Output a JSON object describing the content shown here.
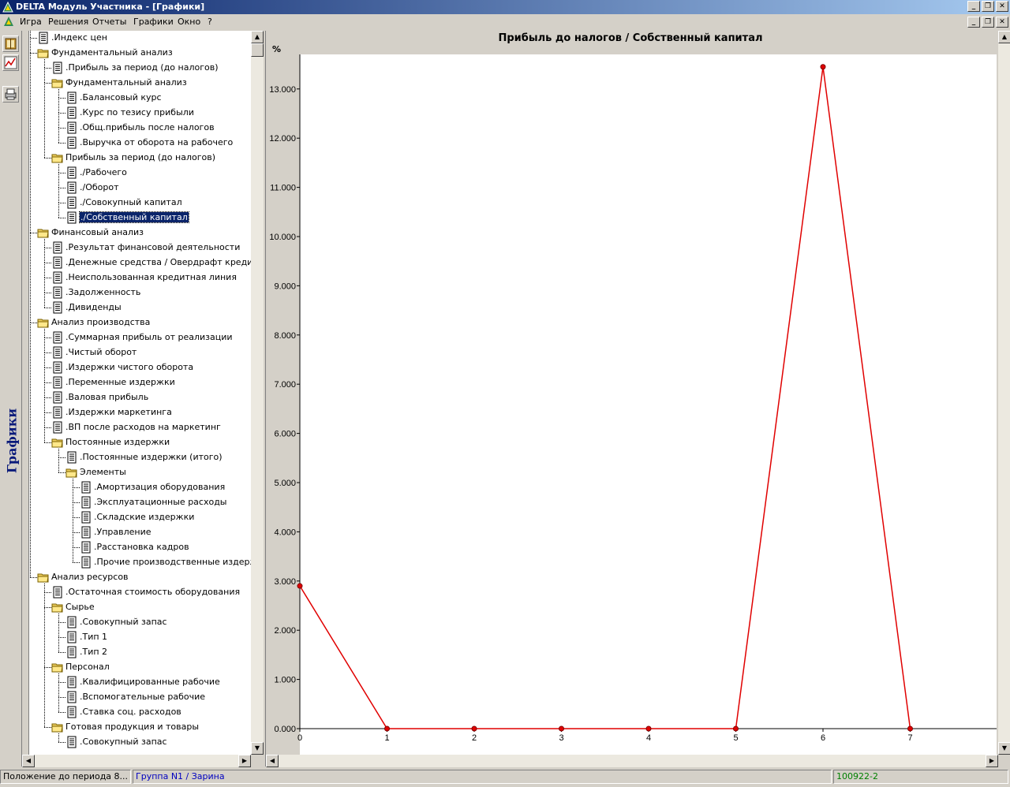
{
  "window": {
    "title": "DELTA Модуль Участника - [Графики]"
  },
  "menu": [
    {
      "label": "Игра",
      "name": "menu-game"
    },
    {
      "label": "Решения",
      "name": "menu-decisions"
    },
    {
      "label": "Отчеты",
      "name": "menu-reports"
    },
    {
      "label": "Графики",
      "name": "menu-charts"
    },
    {
      "label": "Окно",
      "name": "menu-window"
    },
    {
      "label": "?",
      "name": "menu-help"
    }
  ],
  "sidebar": {
    "label": "Графики",
    "buttons": [
      "book-icon",
      "chart-icon",
      "printer-icon"
    ]
  },
  "tree": [
    {
      "level": 0,
      "type": "doc",
      "label": ".Индекс цен"
    },
    {
      "level": 0,
      "type": "folder",
      "label": "Фундаментальный анализ"
    },
    {
      "level": 1,
      "type": "doc",
      "label": ".Прибыль за период (до налогов)"
    },
    {
      "level": 1,
      "type": "folder",
      "label": "Фундаментальный анализ"
    },
    {
      "level": 2,
      "type": "doc",
      "label": ".Балансовый курс"
    },
    {
      "level": 2,
      "type": "doc",
      "label": ".Курс по тезису прибыли"
    },
    {
      "level": 2,
      "type": "doc",
      "label": ".Общ.прибыль после налогов"
    },
    {
      "level": 2,
      "type": "doc",
      "label": ".Выручка от оборота на рабочего"
    },
    {
      "level": 1,
      "type": "folder",
      "label": "Прибыль за период (до налогов)"
    },
    {
      "level": 2,
      "type": "doc",
      "label": "./Рабочего"
    },
    {
      "level": 2,
      "type": "doc",
      "label": "./Оборот"
    },
    {
      "level": 2,
      "type": "doc",
      "label": "./Совокупный капитал"
    },
    {
      "level": 2,
      "type": "doc",
      "label": "./Собственный капитал",
      "selected": true
    },
    {
      "level": 0,
      "type": "folder",
      "label": "Финансовый анализ"
    },
    {
      "level": 1,
      "type": "doc",
      "label": ".Результат финансовой деятельности"
    },
    {
      "level": 1,
      "type": "doc",
      "label": ".Денежные средства / Овердрафт кредит"
    },
    {
      "level": 1,
      "type": "doc",
      "label": ".Неиспользованная кредитная линия"
    },
    {
      "level": 1,
      "type": "doc",
      "label": ".Задолженность"
    },
    {
      "level": 1,
      "type": "doc",
      "label": ".Дивиденды"
    },
    {
      "level": 0,
      "type": "folder",
      "label": "Анализ производства"
    },
    {
      "level": 1,
      "type": "doc",
      "label": ".Суммарная прибыль от реализации"
    },
    {
      "level": 1,
      "type": "doc",
      "label": ".Чистый оборот"
    },
    {
      "level": 1,
      "type": "doc",
      "label": ".Издержки чистого оборота"
    },
    {
      "level": 1,
      "type": "doc",
      "label": ".Переменные издержки"
    },
    {
      "level": 1,
      "type": "doc",
      "label": ".Валовая прибыль"
    },
    {
      "level": 1,
      "type": "doc",
      "label": ".Издержки маркетинга"
    },
    {
      "level": 1,
      "type": "doc",
      "label": ".ВП после расходов на маркетинг"
    },
    {
      "level": 1,
      "type": "folder",
      "label": "Постоянные издержки"
    },
    {
      "level": 2,
      "type": "doc",
      "label": ".Постоянные издержки (итого)"
    },
    {
      "level": 2,
      "type": "folder",
      "label": "Элементы"
    },
    {
      "level": 3,
      "type": "doc",
      "label": ".Амортизация оборудования"
    },
    {
      "level": 3,
      "type": "doc",
      "label": ".Эксплуатационные расходы"
    },
    {
      "level": 3,
      "type": "doc",
      "label": ".Складские издержки"
    },
    {
      "level": 3,
      "type": "doc",
      "label": ".Управление"
    },
    {
      "level": 3,
      "type": "doc",
      "label": ".Расстановка кадров"
    },
    {
      "level": 3,
      "type": "doc",
      "label": ".Прочие производственные издержки"
    },
    {
      "level": 0,
      "type": "folder",
      "label": "Анализ ресурсов"
    },
    {
      "level": 1,
      "type": "doc",
      "label": ".Остаточная стоимость оборудования"
    },
    {
      "level": 1,
      "type": "folder",
      "label": "Сырье"
    },
    {
      "level": 2,
      "type": "doc",
      "label": ".Совокупный запас"
    },
    {
      "level": 2,
      "type": "doc",
      "label": ".Тип 1"
    },
    {
      "level": 2,
      "type": "doc",
      "label": ".Тип 2"
    },
    {
      "level": 1,
      "type": "folder",
      "label": "Персонал"
    },
    {
      "level": 2,
      "type": "doc",
      "label": ".Квалифицированные рабочие"
    },
    {
      "level": 2,
      "type": "doc",
      "label": ".Вспомогательные рабочие"
    },
    {
      "level": 2,
      "type": "doc",
      "label": ".Ставка соц. расходов"
    },
    {
      "level": 1,
      "type": "folder",
      "label": "Готовая продукция и товары"
    },
    {
      "level": 2,
      "type": "doc",
      "label": ".Совокупный запас"
    }
  ],
  "chart_data": {
    "type": "line",
    "title": "Прибыль до налогов / Собственный капитал",
    "ylabel": "%",
    "xlabel": "",
    "x": [
      0,
      1,
      2,
      3,
      4,
      5,
      6,
      7
    ],
    "xticks": [
      "0",
      "1",
      "2",
      "3",
      "4",
      "5",
      "6",
      "7"
    ],
    "xlim": [
      0,
      8
    ],
    "ylim": [
      0,
      13.7
    ],
    "yticks": [
      "0.000",
      "1.000",
      "2.000",
      "3.000",
      "4.000",
      "5.000",
      "6.000",
      "7.000",
      "8.000",
      "9.000",
      "10.000",
      "11.000",
      "12.000",
      "13.000"
    ],
    "ytick_values": [
      0,
      1,
      2,
      3,
      4,
      5,
      6,
      7,
      8,
      9,
      10,
      11,
      12,
      13
    ],
    "series": [
      {
        "values": [
          2.9,
          0,
          0,
          0,
          0,
          0,
          13.45,
          0
        ]
      }
    ],
    "grid": false,
    "colors": {
      "line": "#e00000",
      "marker_fill": "#e00000",
      "marker_edge": "#800000"
    }
  },
  "status": {
    "position": "Положение до периода 8...",
    "group": "Группа N1 / Зарина",
    "code": "100922-2"
  },
  "colors": {
    "titlebar_start": "#0a246a",
    "titlebar_end": "#a6caf0",
    "face": "#d4d0c8",
    "selection": "#0a246a",
    "sidebar_label": "#0a1a7a"
  }
}
